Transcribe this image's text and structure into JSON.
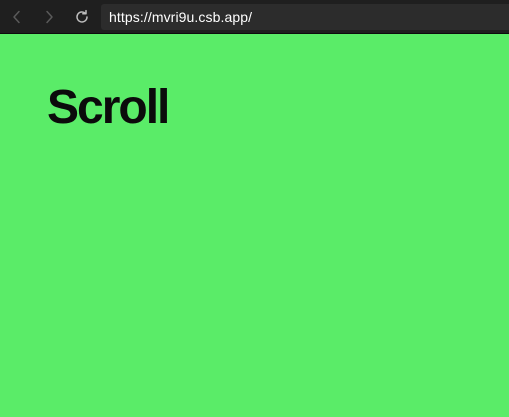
{
  "browser": {
    "url": "https://mvri9u.csb.app/",
    "icons": {
      "back": "chevron-left-icon",
      "forward": "chevron-right-icon",
      "reload": "reload-icon"
    }
  },
  "page": {
    "title": "Scroll",
    "background_color": "#5AEC68",
    "text_color": "#0b0b0b"
  }
}
